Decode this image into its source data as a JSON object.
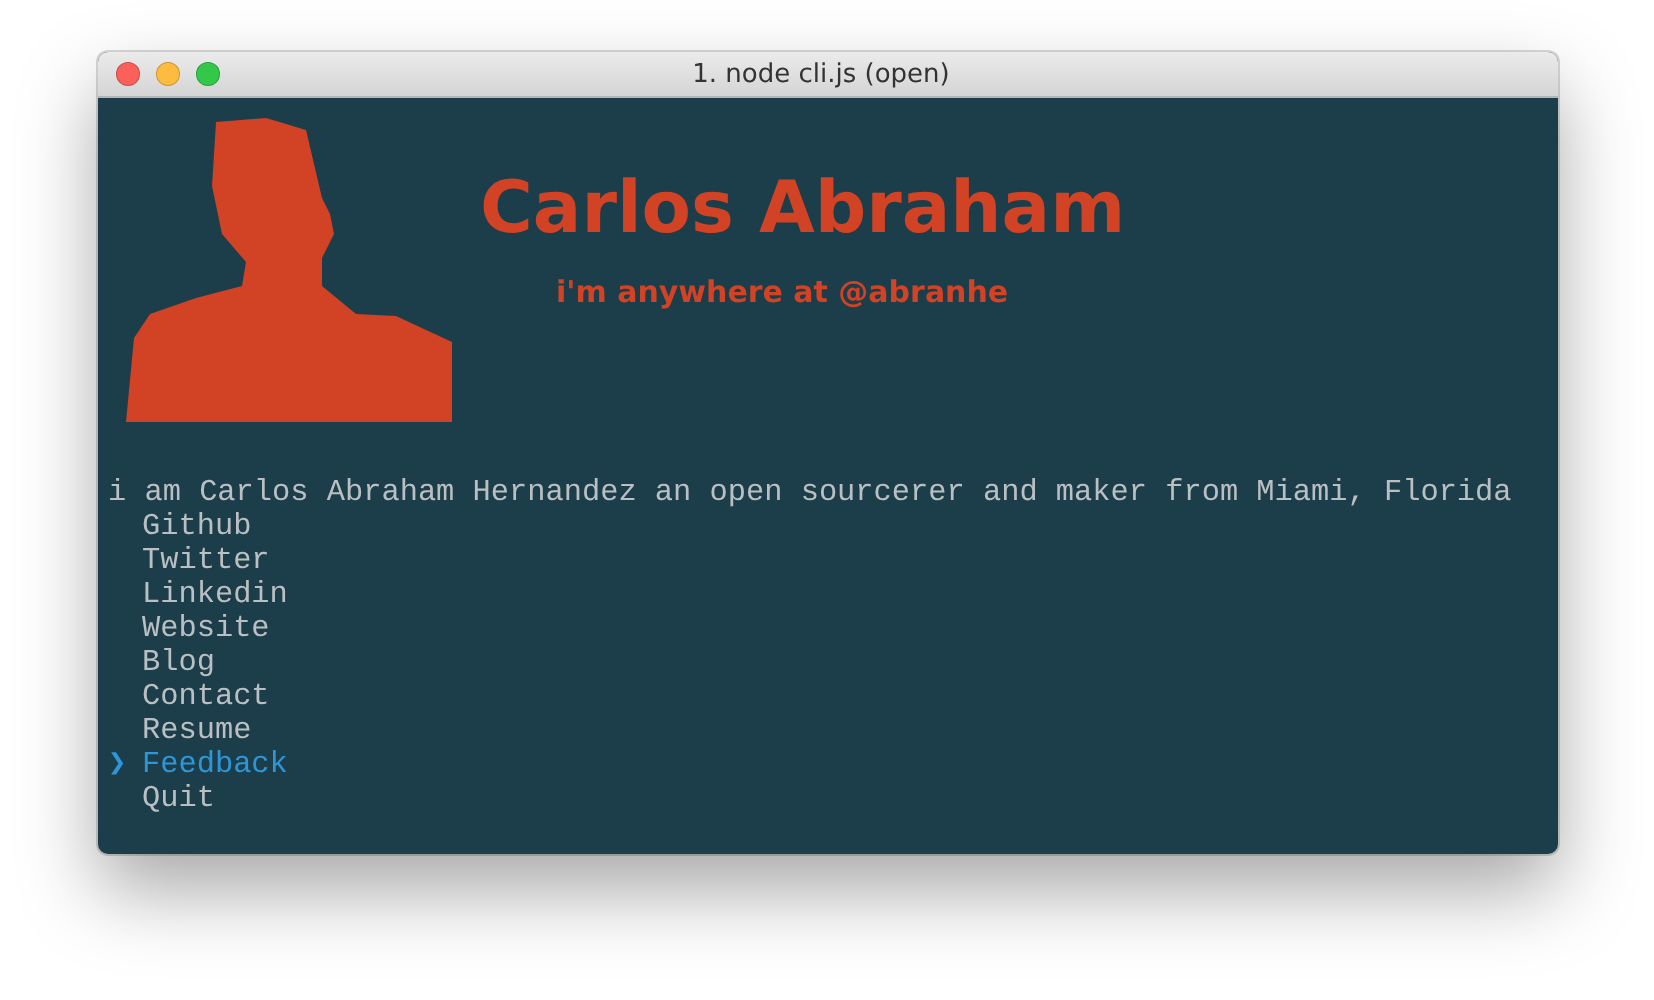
{
  "window": {
    "title": "1. node cli.js (open)"
  },
  "header": {
    "name": "Carlos Abraham",
    "tagline": "i'm anywhere at @abranhe"
  },
  "intro": "i am Carlos Abraham Hernandez an open sourcerer and maker from Miami, Florida",
  "menu": {
    "pointer": "❯",
    "items": [
      {
        "label": "Github",
        "selected": false
      },
      {
        "label": "Twitter",
        "selected": false
      },
      {
        "label": "Linkedin",
        "selected": false
      },
      {
        "label": "Website",
        "selected": false
      },
      {
        "label": "Blog",
        "selected": false
      },
      {
        "label": "Contact",
        "selected": false
      },
      {
        "label": "Resume",
        "selected": false
      },
      {
        "label": "Feedback",
        "selected": true
      },
      {
        "label": "Quit",
        "selected": false
      }
    ]
  }
}
